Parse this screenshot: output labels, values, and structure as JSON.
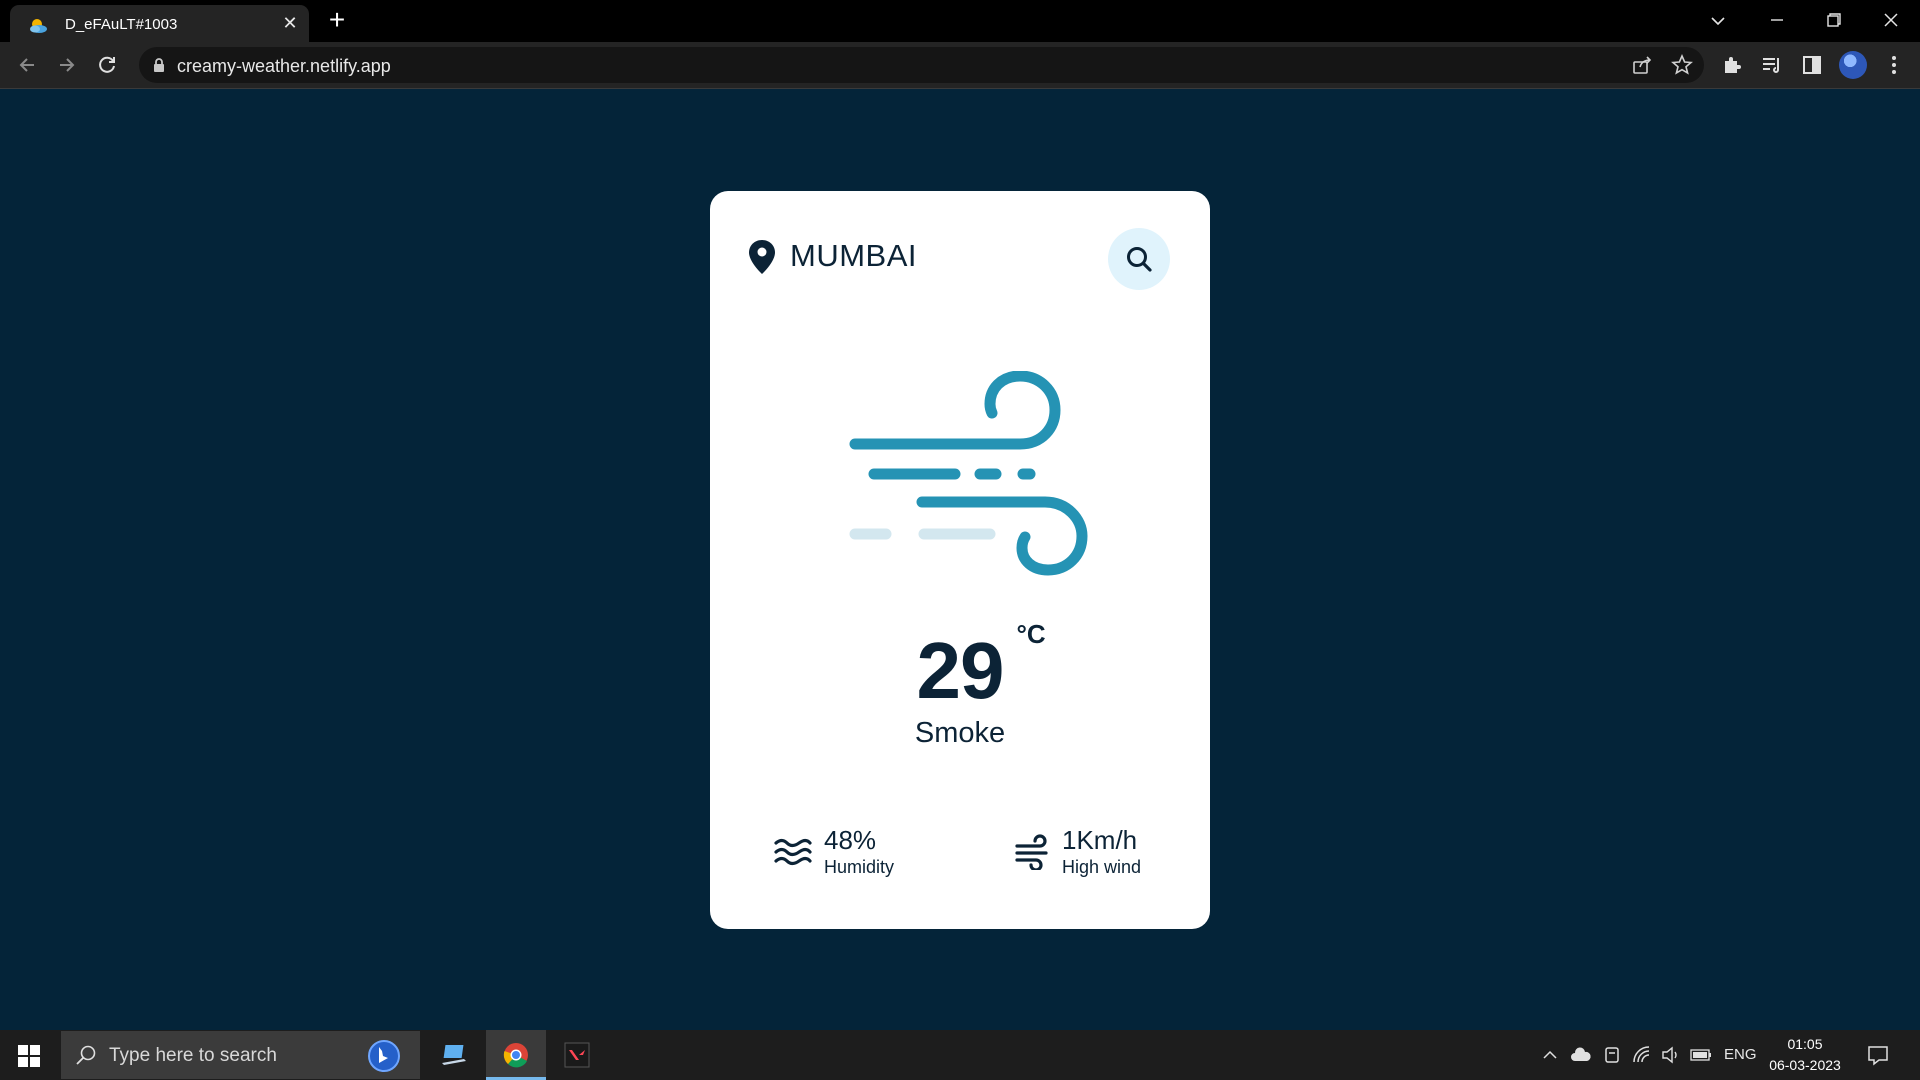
{
  "browser": {
    "tab_title": "D_eFAuLT#1003",
    "url": "creamy-weather.netlify.app",
    "tab_close_glyph": "✕",
    "new_tab_glyph": "+",
    "icons": [
      "favicon-icon",
      "back-arrow-icon",
      "forward-arrow-icon",
      "reload-icon",
      "lock-icon",
      "share-icon",
      "star-icon",
      "extensions-icon",
      "reading-list-icon",
      "side-panel-icon",
      "avatar",
      "more-menu-icon",
      "tab-search-icon",
      "minimize-icon",
      "restore-icon",
      "close-window-icon"
    ]
  },
  "weather": {
    "city": "MUMBAI",
    "temperature": "29",
    "unit": "°C",
    "condition": "Smoke",
    "humidity_value": "48%",
    "humidity_label": "Humidity",
    "wind_value": "1Km/h",
    "wind_label": "High wind",
    "icons": [
      "location-pin-icon",
      "search-icon",
      "wind-illustration",
      "humidity-icon",
      "wind-icon"
    ],
    "colors": {
      "background": "#042439",
      "card": "#ffffff",
      "text": "#0c2336",
      "accent": "#1e9ab8",
      "search_bg": "#e0f3fc"
    }
  },
  "taskbar": {
    "search_placeholder": "Type here to search",
    "language": "ENG",
    "time": "01:05",
    "date": "06-03-2023"
  }
}
